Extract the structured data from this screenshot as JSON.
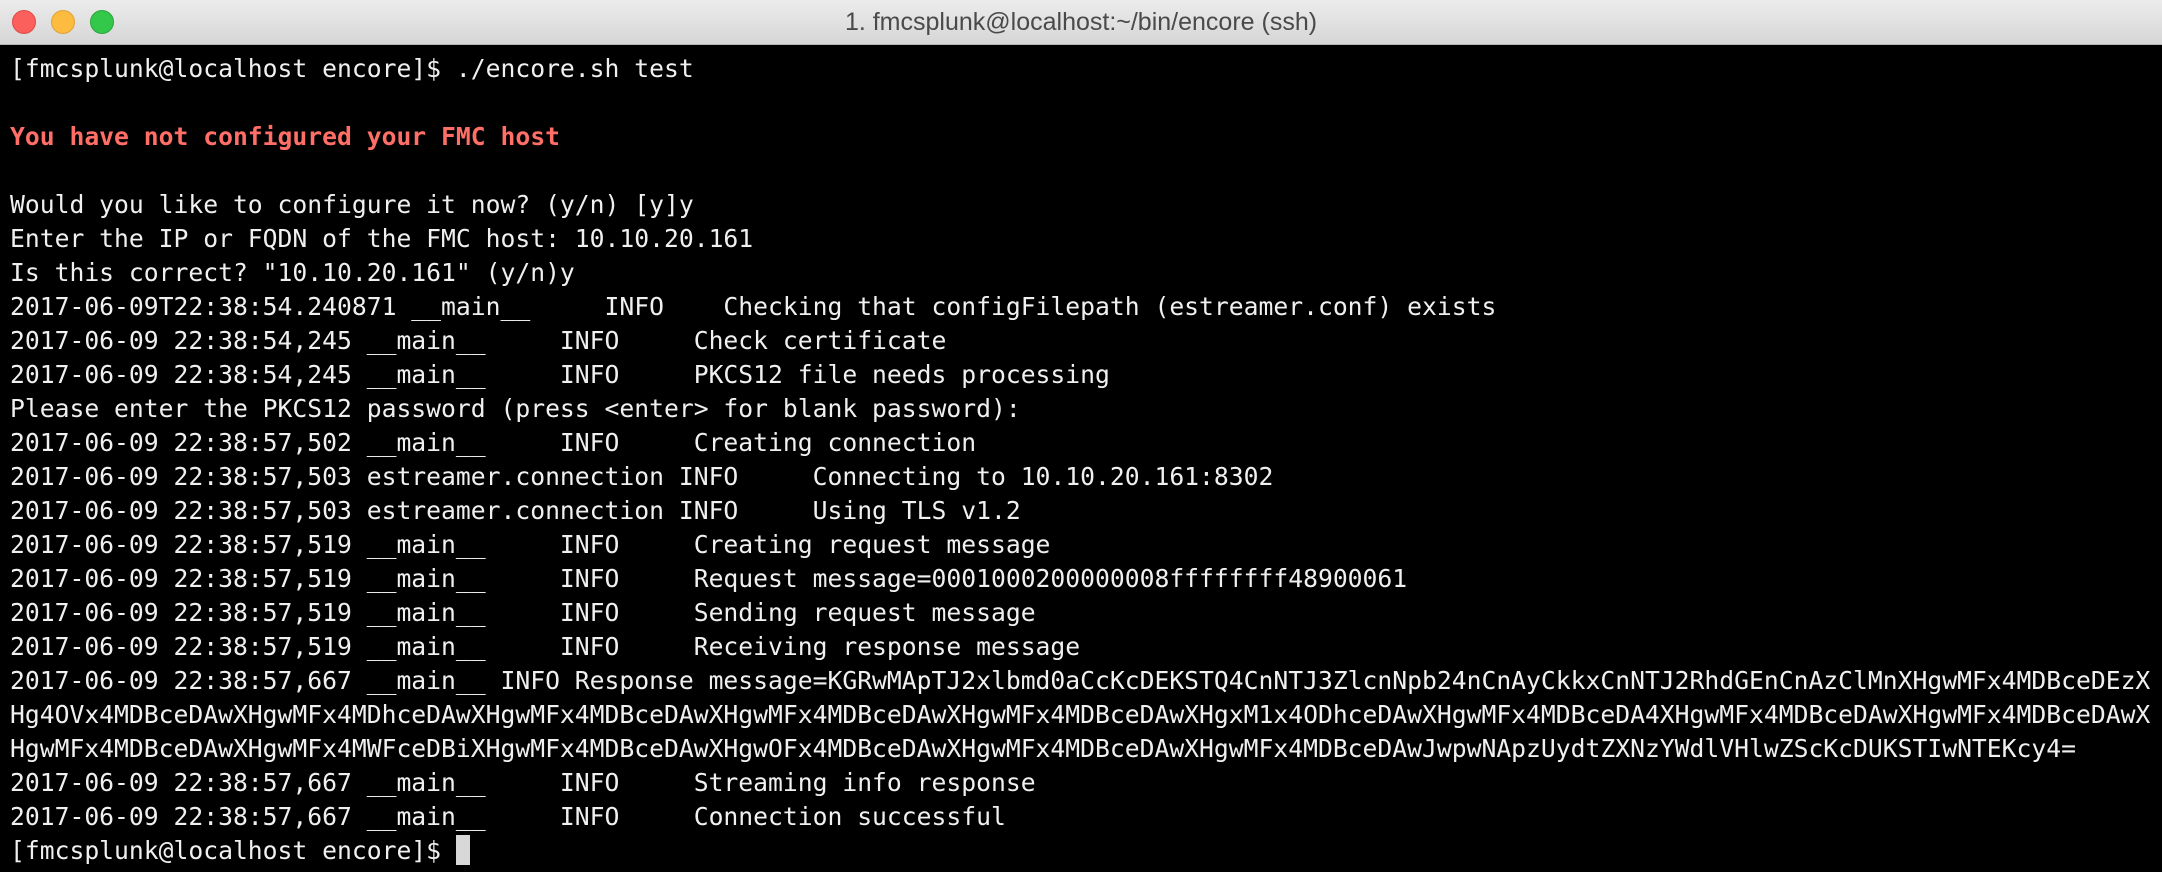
{
  "window": {
    "title": "1. fmcsplunk@localhost:~/bin/encore (ssh)"
  },
  "terminal": {
    "lines": [
      "[fmcsplunk@localhost encore]$ ./encore.sh test",
      "",
      "You have not configured your FMC host",
      "",
      "Would you like to configure it now? (y/n) [y]y",
      "Enter the IP or FQDN of the FMC host: 10.10.20.161",
      "Is this correct? \"10.10.20.161\" (y/n)y",
      "2017-06-09T22:38:54.240871 __main__     INFO    Checking that configFilepath (estreamer.conf) exists",
      "2017-06-09 22:38:54,245 __main__     INFO     Check certificate",
      "2017-06-09 22:38:54,245 __main__     INFO     PKCS12 file needs processing",
      "Please enter the PKCS12 password (press <enter> for blank password):",
      "2017-06-09 22:38:57,502 __main__     INFO     Creating connection",
      "2017-06-09 22:38:57,503 estreamer.connection INFO     Connecting to 10.10.20.161:8302",
      "2017-06-09 22:38:57,503 estreamer.connection INFO     Using TLS v1.2",
      "2017-06-09 22:38:57,519 __main__     INFO     Creating request message",
      "2017-06-09 22:38:57,519 __main__     INFO     Request message=0001000200000008ffffffff48900061",
      "2017-06-09 22:38:57,519 __main__     INFO     Sending request message",
      "2017-06-09 22:38:57,519 __main__     INFO     Receiving response message",
      "2017-06-09 22:38:57,667 __main__     INFO     Response message=KGRwMApTJ2xlbmd0aCcKcDEKSTQ4CnNTJ3ZlcnNpb24nCnAyCkkxCnNTJ2RhdGEnCnAzClMnXHgwMFx4MDBceDEzXHg4OVx4MDBceDAwXHgwMFx4MDhceDAwXHgwMFx4MDBceDAwXHgwMFx4MDBceDAwXHgwMFx4MDBceDAwXHgxM1x4ODhceDAwXHgwMFx4MDBceDA4XHgwMFx4MDBceDAwXHgwMFx4MDBceDAwXHgwMFx4MDBceDAwXHgwMFx4MWFceDBiXHgwMFx4MDBceDAwXHgwOFx4MDBceDAwXHgwMFx4MDBceDAwXHgwMFx4MDBceDAwJwpwNApzUydtZXNzYWdlVHlwZScKcDUKSTIwNTEKcy4=",
      "2017-06-09 22:38:57,667 __main__     INFO     Streaming info response",
      "2017-06-09 22:38:57,667 __main__     INFO     Connection successful",
      "[fmcsplunk@localhost encore]$ "
    ]
  }
}
